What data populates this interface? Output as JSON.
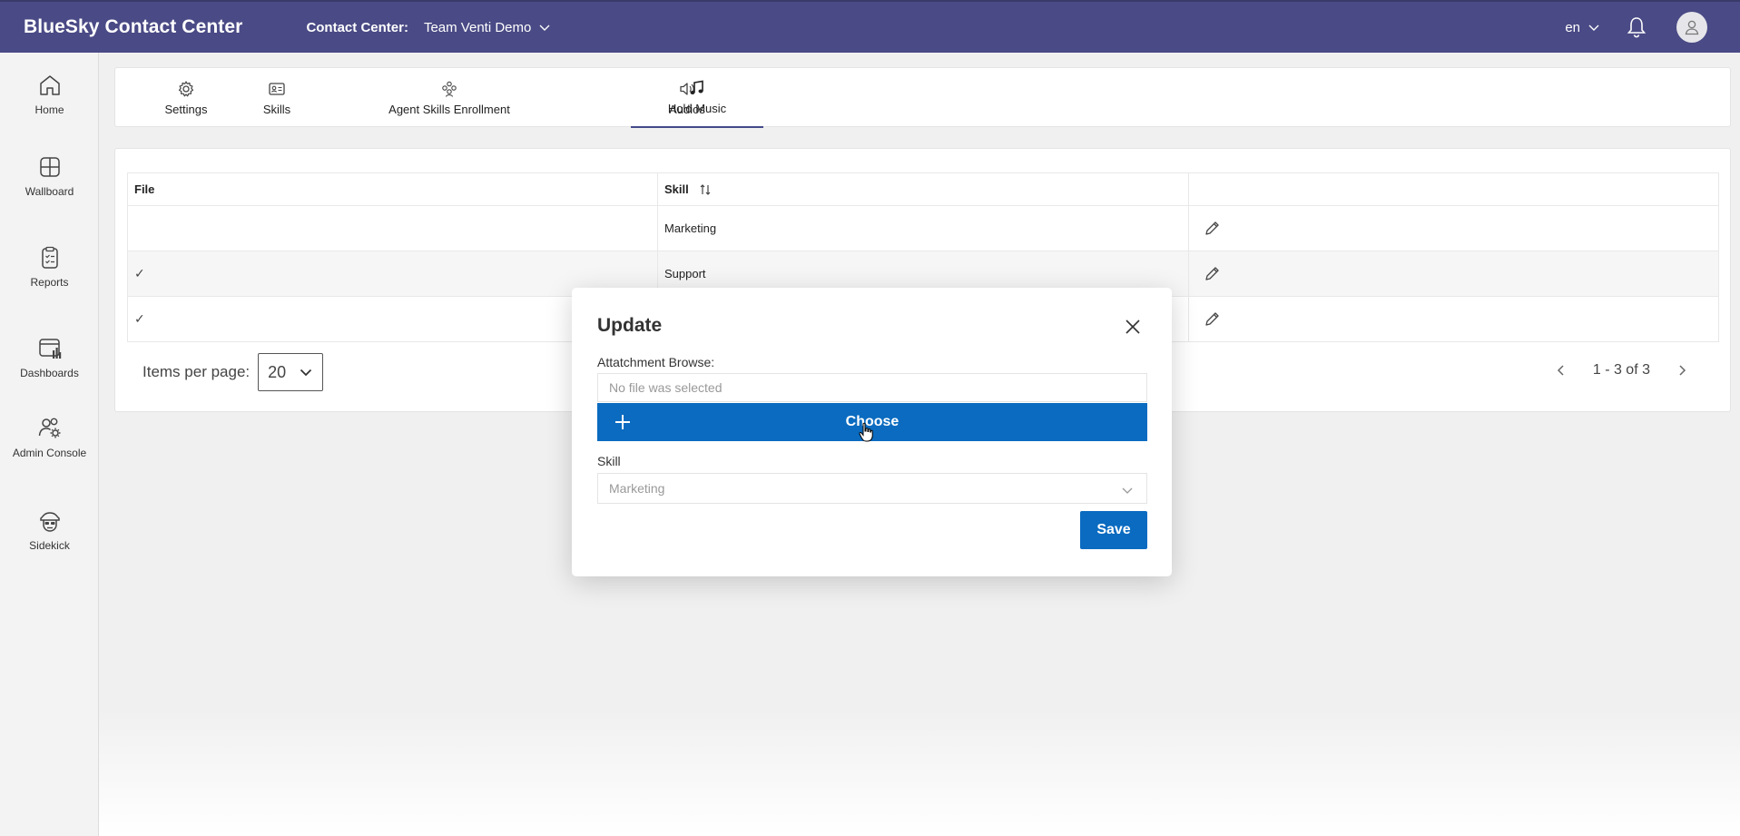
{
  "header": {
    "brand": "BlueSky Contact Center",
    "contact_center_label": "Contact Center:",
    "contact_center_value": "Team Venti Demo",
    "language": "en"
  },
  "sidebar": {
    "items": [
      {
        "label": "Home",
        "icon": "home-icon"
      },
      {
        "label": "Wallboard",
        "icon": "wallboard-icon"
      },
      {
        "label": "Reports",
        "icon": "reports-icon"
      },
      {
        "label": "Dashboards",
        "icon": "dashboards-icon"
      },
      {
        "label": "Admin Console",
        "icon": "admin-console-icon"
      },
      {
        "label": "Sidekick",
        "icon": "sidekick-icon"
      }
    ]
  },
  "tabs": [
    {
      "label": "Settings",
      "icon": "gear-icon"
    },
    {
      "label": "Skills",
      "icon": "id-card-icon"
    },
    {
      "label": "Agent Skills Enrollment",
      "icon": "people-icon"
    },
    {
      "label": "Audios",
      "icon": "speaker-icon"
    },
    {
      "label": "Hold Music",
      "icon": "music-note-icon",
      "active": true
    }
  ],
  "table": {
    "columns": [
      "File",
      "Skill",
      ""
    ],
    "rows": [
      {
        "file": "",
        "skill": "Marketing"
      },
      {
        "file": "✓",
        "skill": "Support"
      },
      {
        "file": "✓",
        "skill": ""
      }
    ]
  },
  "pagination": {
    "items_per_page_label": "Items per page:",
    "items_per_page_value": "20",
    "range": "1 - 3 of 3"
  },
  "modal": {
    "title": "Update",
    "attachment_label": "Attatchment Browse:",
    "file_placeholder": "No file was selected",
    "choose_label": "Choose",
    "skill_label": "Skill",
    "skill_value": "Marketing",
    "save_label": "Save"
  },
  "colors": {
    "header_bg": "#4a4a86",
    "primary_button": "#0a6bc0"
  }
}
